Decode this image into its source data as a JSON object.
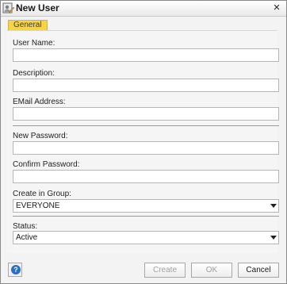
{
  "window": {
    "title": "New User",
    "close_glyph": "×",
    "icon": "user-edit-icon"
  },
  "tabs": {
    "general": "General"
  },
  "form": {
    "user_name": {
      "label": "User Name:",
      "value": ""
    },
    "description": {
      "label": "Description:",
      "value": ""
    },
    "email": {
      "label": "EMail Address:",
      "value": ""
    },
    "new_password": {
      "label": "New Password:",
      "value": ""
    },
    "confirm_password": {
      "label": "Confirm Password:",
      "value": ""
    },
    "group": {
      "label": "Create in Group:",
      "value": "EVERYONE"
    },
    "status": {
      "label": "Status:",
      "value": "Active"
    }
  },
  "buttons": {
    "help": "?",
    "create": "Create",
    "ok": "OK",
    "cancel": "Cancel"
  },
  "colors": {
    "tab_active": "#f5d44a",
    "help_icon": "#2b6fc4"
  }
}
